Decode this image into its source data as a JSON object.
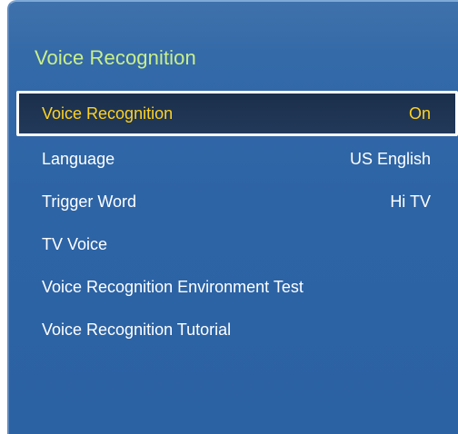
{
  "panel": {
    "title": "Voice Recognition"
  },
  "menu": {
    "items": [
      {
        "label": "Voice Recognition",
        "value": "On"
      },
      {
        "label": "Language",
        "value": "US English"
      },
      {
        "label": "Trigger Word",
        "value": "Hi TV"
      },
      {
        "label": "TV Voice",
        "value": ""
      },
      {
        "label": "Voice Recognition Environment Test",
        "value": ""
      },
      {
        "label": "Voice Recognition Tutorial",
        "value": ""
      }
    ],
    "selected_index": 0
  },
  "colors": {
    "panel_bg": "#2d64a6",
    "title": "#c9f08a",
    "selected_text": "#ffd21f",
    "selected_bg": "#1b2f4a",
    "text": "#ffffff"
  }
}
